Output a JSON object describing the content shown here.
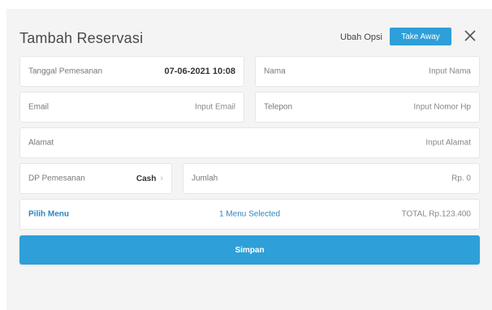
{
  "header": {
    "title": "Tambah Reservasi",
    "ubah_opsi": "Ubah Opsi",
    "take_away": "Take Away",
    "close_icon": "close-icon"
  },
  "form": {
    "tanggal": {
      "label": "Tanggal Pemesanan",
      "value": "07-06-2021 10:08"
    },
    "nama": {
      "label": "Nama",
      "placeholder": "Input Nama"
    },
    "email": {
      "label": "Email",
      "placeholder": "Input Email"
    },
    "telepon": {
      "label": "Telepon",
      "placeholder": "Input Nomor Hp"
    },
    "alamat": {
      "label": "Alamat",
      "placeholder": "Input Alamat"
    },
    "dp": {
      "label": "DP Pemesanan",
      "value": "Cash",
      "chevron": "›"
    },
    "jumlah": {
      "label": "Jumlah",
      "value": "Rp. 0"
    }
  },
  "menu": {
    "pilih_label": "Pilih Menu",
    "selected_text": "1 Menu Selected",
    "total_text": "TOTAL Rp.123.400"
  },
  "actions": {
    "simpan_label": "Simpan"
  },
  "colors": {
    "accent": "#2e9fd8",
    "link": "#2e86c1"
  }
}
